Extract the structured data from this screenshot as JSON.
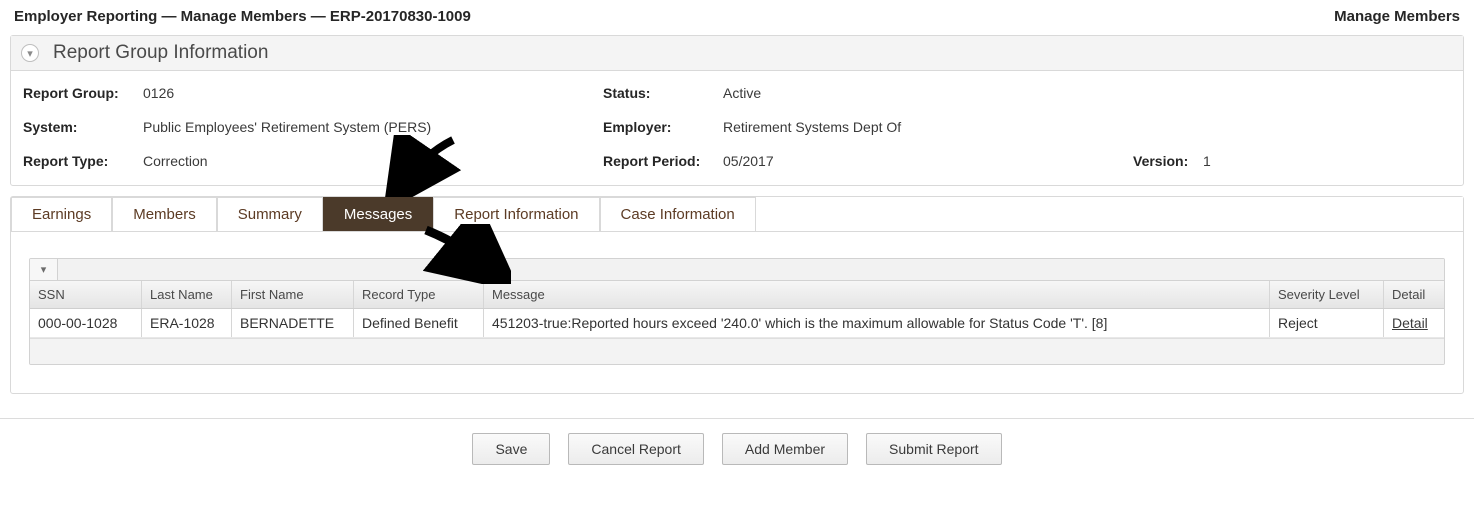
{
  "header": {
    "breadcrumb": "Employer Reporting — Manage Members — ERP-20170830-1009",
    "right_title": "Manage Members"
  },
  "panel": {
    "title": "Report Group Information",
    "fields": {
      "report_group_label": "Report Group:",
      "report_group_value": "0126",
      "system_label": "System:",
      "system_value": "Public Employees' Retirement System (PERS)",
      "report_type_label": "Report Type:",
      "report_type_value": "Correction",
      "status_label": "Status:",
      "status_value": "Active",
      "employer_label": "Employer:",
      "employer_value": "Retirement Systems Dept Of",
      "report_period_label": "Report Period:",
      "report_period_value": "05/2017",
      "version_label": "Version:",
      "version_value": "1"
    }
  },
  "tabs": {
    "earnings": "Earnings",
    "members": "Members",
    "summary": "Summary",
    "messages": "Messages",
    "report_info": "Report Information",
    "case_info": "Case Information"
  },
  "grid": {
    "headers": {
      "ssn": "SSN",
      "last_name": "Last Name",
      "first_name": "First Name",
      "record_type": "Record Type",
      "message": "Message",
      "severity": "Severity Level",
      "detail": "Detail"
    },
    "rows": [
      {
        "ssn": "000-00-1028",
        "last_name": "ERA-1028",
        "first_name": "BERNADETTE",
        "record_type": "Defined Benefit",
        "message": "451203-true:Reported hours exceed '240.0' which is the maximum allowable for Status Code 'T'. [8]",
        "severity": "Reject",
        "detail": "Detail"
      }
    ]
  },
  "buttons": {
    "save": "Save",
    "cancel": "Cancel Report",
    "add_member": "Add Member",
    "submit": "Submit Report"
  }
}
